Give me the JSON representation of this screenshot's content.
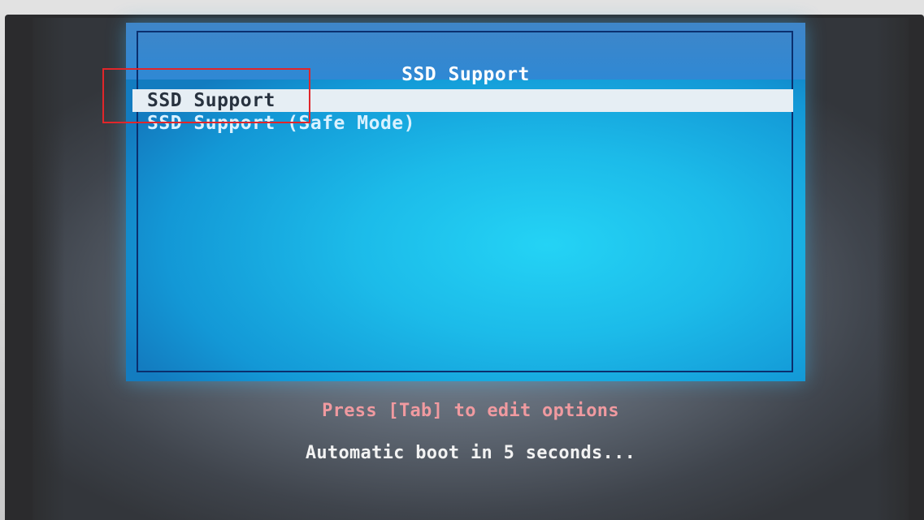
{
  "boot_menu": {
    "title": "SSD Support",
    "items": [
      {
        "label": "SSD Support",
        "selected": true
      },
      {
        "label": "SSD Support (Safe Mode)",
        "selected": false
      }
    ]
  },
  "hints": {
    "edit_options": "Press [Tab] to edit options",
    "countdown": "Automatic boot in 5 seconds..."
  },
  "colors": {
    "panel_background": "#1cbbe9",
    "selection_highlight": "#e6eef4",
    "hint_edit_text": "#f09aa0",
    "countdown_text": "#f2f2f2",
    "annotation_outline": "#e0262a"
  }
}
